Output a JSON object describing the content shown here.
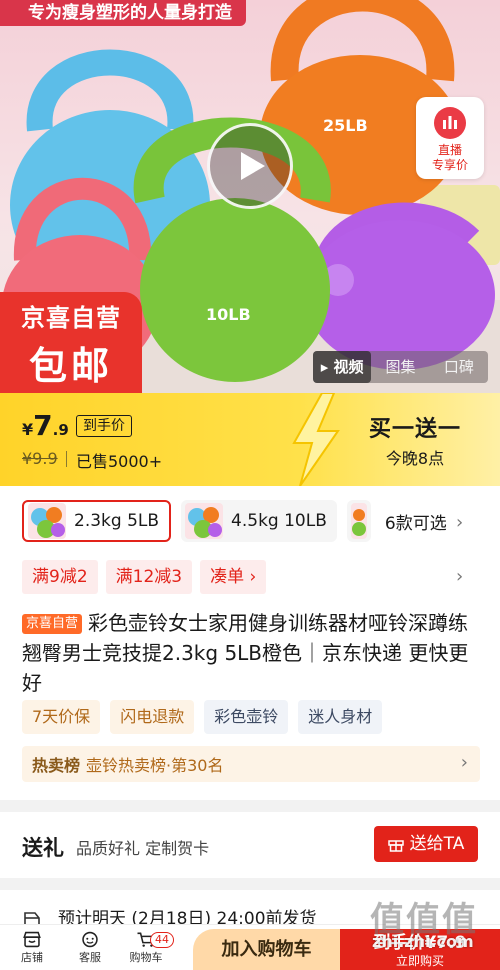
{
  "hero": {
    "banner": "专为瘦身塑形的人量身打造",
    "live_chip": {
      "line1": "直播",
      "line2": "专享价"
    },
    "kettlebell_labels": {
      "orange": "25LB",
      "green": "10LB"
    },
    "badge": {
      "line1": "京喜自营",
      "line2": "包邮"
    },
    "media_tabs": [
      "视频",
      "图集",
      "口碑"
    ],
    "active_media_tab": "视频"
  },
  "price": {
    "currency": "¥",
    "integer": "7",
    "decimal": ".9",
    "hand_price_label": "到手价",
    "original": "¥9.9",
    "sold": "已售5000+",
    "promo_main": "买一送一",
    "promo_sub": "今晚8点"
  },
  "variants": {
    "items": [
      "2.3kg 5LB",
      "4.5kg 10LB"
    ],
    "more": "6款可选"
  },
  "coupons": [
    "满9减2",
    "满12减3",
    "凑单 ›"
  ],
  "product": {
    "self_tag": "京喜自营",
    "title": "彩色壶铃女士家用健身训练器材哑铃深蹲练翘臀男士竞技提2.3kg 5LB橙色｜京东快递 更快更好"
  },
  "tags": [
    {
      "label": "7天价保",
      "style": "orange"
    },
    {
      "label": "闪电退款",
      "style": "orange"
    },
    {
      "label": "彩色壶铃",
      "style": "blue"
    },
    {
      "label": "迷人身材",
      "style": "blue"
    }
  ],
  "rank": {
    "title": "热卖榜",
    "text": "壶铃热卖榜·第30名"
  },
  "gift": {
    "heading": "送礼",
    "sub": "品质好礼  定制贺卡",
    "button": "送给TA"
  },
  "delivery": {
    "text": "预计明天 (2月18日) 24:00前发货"
  },
  "bottom": {
    "nav": [
      "店铺",
      "客服",
      "购物车"
    ],
    "cart_count": "44",
    "add_cart": "加入购物车",
    "buy_line1": "到手价¥7.9",
    "buy_line2": "立即购买"
  },
  "watermark": {
    "logo": "值值值",
    "url": "zhi.zhi.com"
  },
  "colors": {
    "jd_red": "#e2231a",
    "price_yellow": "#ffd329",
    "accent_orange": "#ff6a28"
  }
}
